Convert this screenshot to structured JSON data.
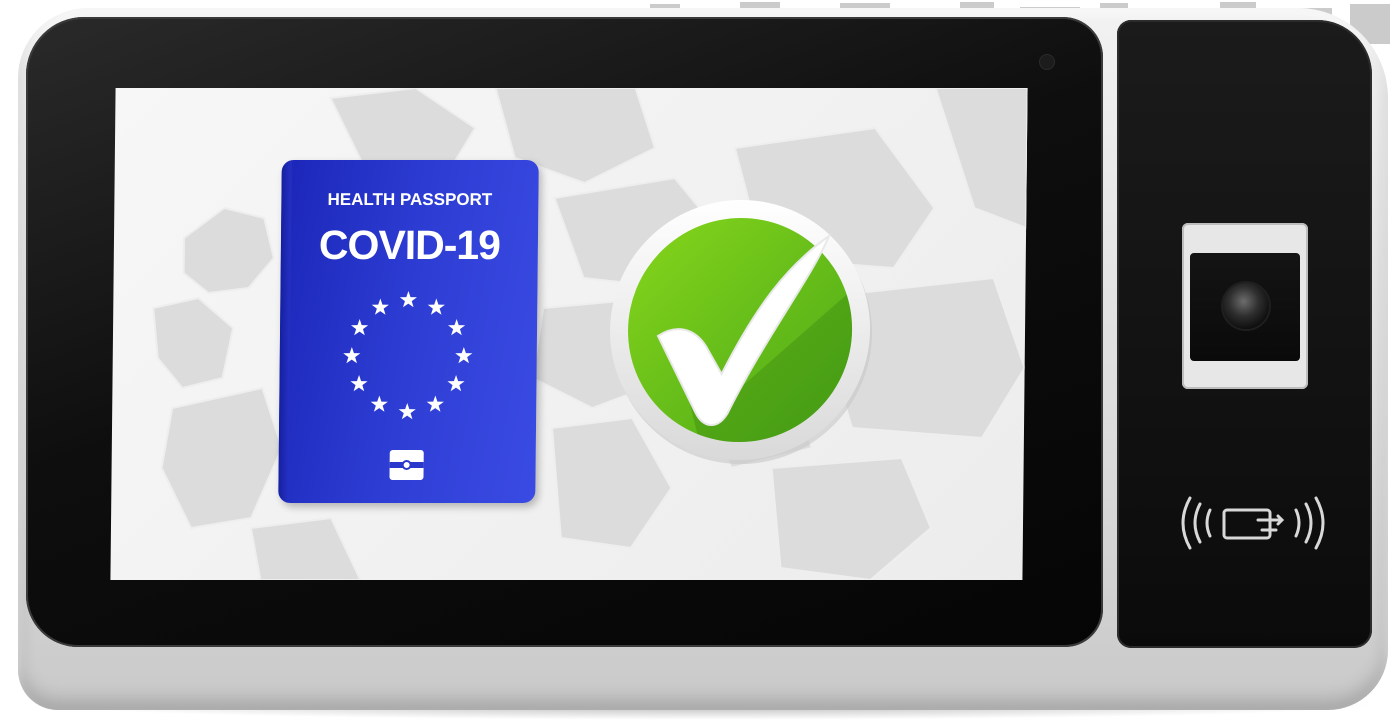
{
  "passport": {
    "header": "HEALTH PASSPORT",
    "title": "COVID-19"
  },
  "icons": {
    "stars": "eu-stars-icon",
    "chip": "chip-icon",
    "check": "checkmark-icon",
    "nfc": "nfc-contactless-icon",
    "camera": "camera-lens-icon"
  },
  "colors": {
    "passport_blue": "#2a38cc",
    "check_green": "#6cc21a",
    "device_body": "#e4e4e4",
    "bezel_black": "#0b0b0b"
  }
}
